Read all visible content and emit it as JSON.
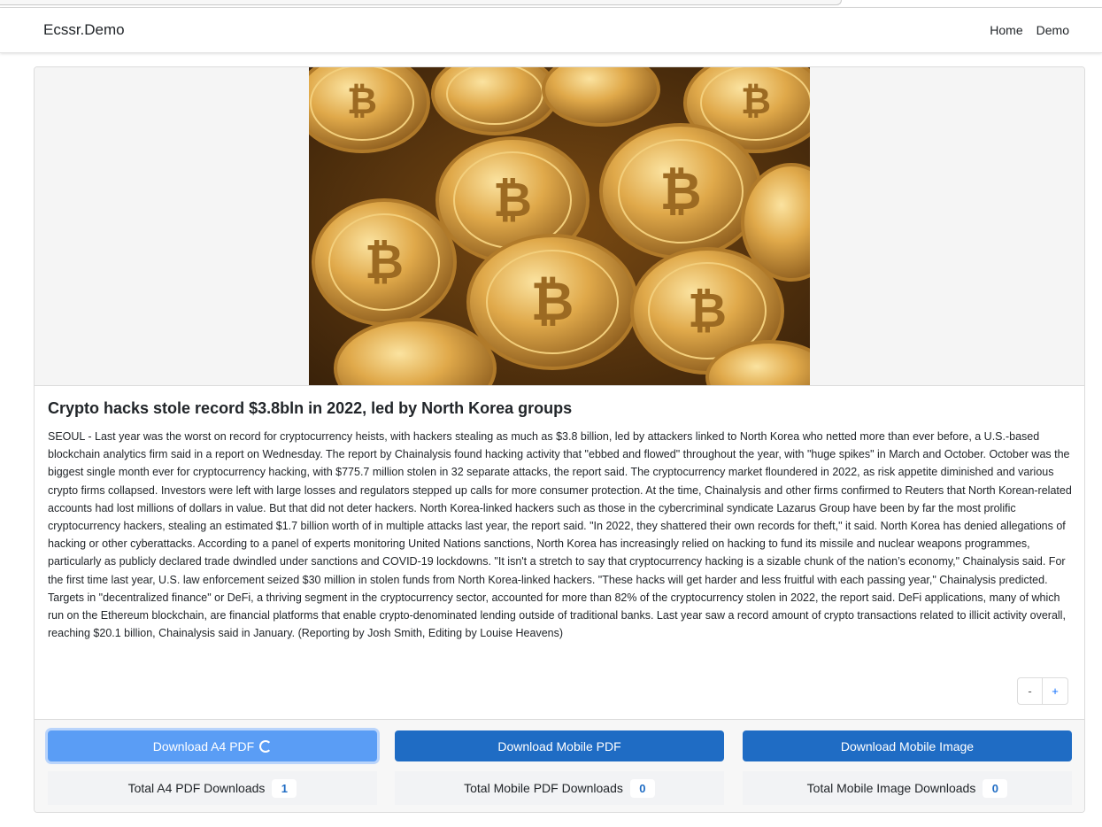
{
  "nav": {
    "brand": "Ecssr.Demo",
    "links": [
      "Home",
      "Demo"
    ]
  },
  "article": {
    "image_alt": "Gold bitcoin coins",
    "title": "Crypto hacks stole record $3.8bln in 2022, led by North Korea groups",
    "body": "SEOUL - Last year was the worst on record for cryptocurrency heists, with hackers stealing as much as $3.8 billion, led by attackers linked to North Korea who netted more than ever before, a U.S.-based blockchain analytics firm said in a report on Wednesday. The report by Chainalysis found hacking activity that \"ebbed and flowed\" throughout the year, with \"huge spikes\" in March and October. October was the biggest single month ever for cryptocurrency hacking, with $775.7 million stolen in 32 separate attacks, the report said. The cryptocurrency market floundered in 2022, as risk appetite diminished and various crypto firms collapsed. Investors were left with large losses and regulators stepped up calls for more consumer protection. At the time, Chainalysis and other firms confirmed to Reuters that North Korean-related accounts had lost millions of dollars in value. But that did not deter hackers. North Korea-linked hackers such as those in the cybercriminal syndicate Lazarus Group have been by far the most prolific cryptocurrency hackers, stealing an estimated $1.7 billion worth of in multiple attacks last year, the report said. \"In 2022, they shattered their own records for theft,\" it said. North Korea has denied allegations of hacking or other cyberattacks. According to a panel of experts monitoring United Nations sanctions, North Korea has increasingly relied on hacking to fund its missile and nuclear weapons programmes, particularly as publicly declared trade dwindled under sanctions and COVID-19 lockdowns. \"It isn't a stretch to say that cryptocurrency hacking is a sizable chunk of the nation’s economy,\" Chainalysis said. For the first time last year, U.S. law enforcement seized $30 million in stolen funds from North Korea-linked hackers. \"These hacks will get harder and less fruitful with each passing year,\" Chainalysis predicted. Targets in \"decentralized finance\" or DeFi, a thriving segment in the cryptocurrency sector, accounted for more than 82% of the cryptocurrency stolen in 2022, the report said. DeFi applications, many of which run on the Ethereum blockchain, are financial platforms that enable crypto-denominated lending outside of traditional banks. Last year saw a record amount of crypto transactions related to illicit activity overall, reaching $20.1 billion, Chainalysis said in January. (Reporting by Josh Smith, Editing by Louise Heavens)"
  },
  "font_controls": {
    "decrease": "-",
    "increase": "+"
  },
  "downloads": {
    "a4_pdf_label": "Download A4 PDF",
    "mobile_pdf_label": "Download Mobile PDF",
    "mobile_image_label": "Download Mobile Image",
    "a4_pdf_total_label": "Total A4 PDF Downloads",
    "a4_pdf_total": "1",
    "mobile_pdf_total_label": "Total Mobile PDF Downloads",
    "mobile_pdf_total": "0",
    "mobile_image_total_label": "Total Mobile Image Downloads",
    "mobile_image_total": "0"
  },
  "colors": {
    "primary": "#1f6cc4",
    "loading": "#5a9df5",
    "coin_gold": "#d9a441"
  },
  "icons": {
    "loading": "spinner-icon"
  }
}
